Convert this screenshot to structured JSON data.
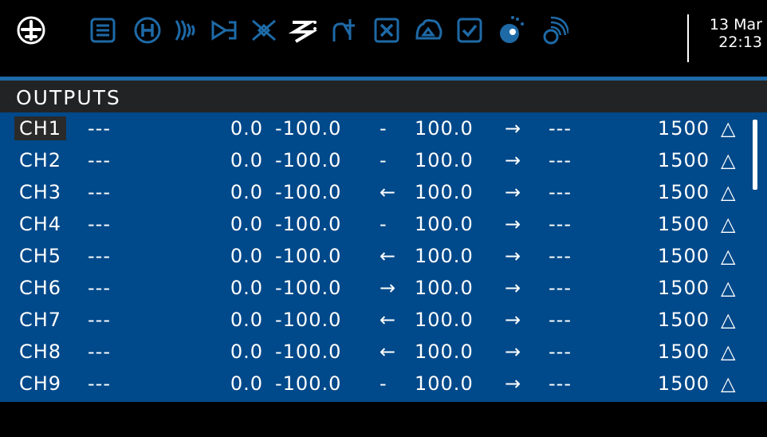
{
  "topbar": {
    "icons": [
      "model-plane-icon",
      "model-setup-icon",
      "heli-icon",
      "flight-modes-icon",
      "inputs-icon",
      "mixes-icon",
      "outputs-icon",
      "curves-icon",
      "logical-switches-icon",
      "special-functions-icon",
      "telemetry-icon",
      "checklist-icon",
      "lua-scripts-icon",
      "lua-widgets-icon"
    ],
    "date": "13 Mar",
    "time": "22:13"
  },
  "page": {
    "title": "OUTPUTS"
  },
  "colors": {
    "accent": "#1e6aa7",
    "row_bg": "#00498a",
    "title_bg": "#222325"
  },
  "outputs": [
    {
      "name": "CH1",
      "source": "---",
      "offset": "0.0",
      "min": "-100.0",
      "direction": "-",
      "max": "100.0",
      "arrow": "→",
      "curve": "---",
      "center": "1500",
      "symbol": "△"
    },
    {
      "name": "CH2",
      "source": "---",
      "offset": "0.0",
      "min": "-100.0",
      "direction": "-",
      "max": "100.0",
      "arrow": "→",
      "curve": "---",
      "center": "1500",
      "symbol": "△"
    },
    {
      "name": "CH3",
      "source": "---",
      "offset": "0.0",
      "min": "-100.0",
      "direction": "←",
      "max": "100.0",
      "arrow": "→",
      "curve": "---",
      "center": "1500",
      "symbol": "△"
    },
    {
      "name": "CH4",
      "source": "---",
      "offset": "0.0",
      "min": "-100.0",
      "direction": "-",
      "max": "100.0",
      "arrow": "→",
      "curve": "---",
      "center": "1500",
      "symbol": "△"
    },
    {
      "name": "CH5",
      "source": "---",
      "offset": "0.0",
      "min": "-100.0",
      "direction": "←",
      "max": "100.0",
      "arrow": "→",
      "curve": "---",
      "center": "1500",
      "symbol": "△"
    },
    {
      "name": "CH6",
      "source": "---",
      "offset": "0.0",
      "min": "-100.0",
      "direction": "→",
      "max": "100.0",
      "arrow": "→",
      "curve": "---",
      "center": "1500",
      "symbol": "△"
    },
    {
      "name": "CH7",
      "source": "---",
      "offset": "0.0",
      "min": "-100.0",
      "direction": "←",
      "max": "100.0",
      "arrow": "→",
      "curve": "---",
      "center": "1500",
      "symbol": "△"
    },
    {
      "name": "CH8",
      "source": "---",
      "offset": "0.0",
      "min": "-100.0",
      "direction": "←",
      "max": "100.0",
      "arrow": "→",
      "curve": "---",
      "center": "1500",
      "symbol": "△"
    },
    {
      "name": "CH9",
      "source": "---",
      "offset": "0.0",
      "min": "-100.0",
      "direction": "-",
      "max": "100.0",
      "arrow": "→",
      "curve": "---",
      "center": "1500",
      "symbol": "△"
    }
  ]
}
